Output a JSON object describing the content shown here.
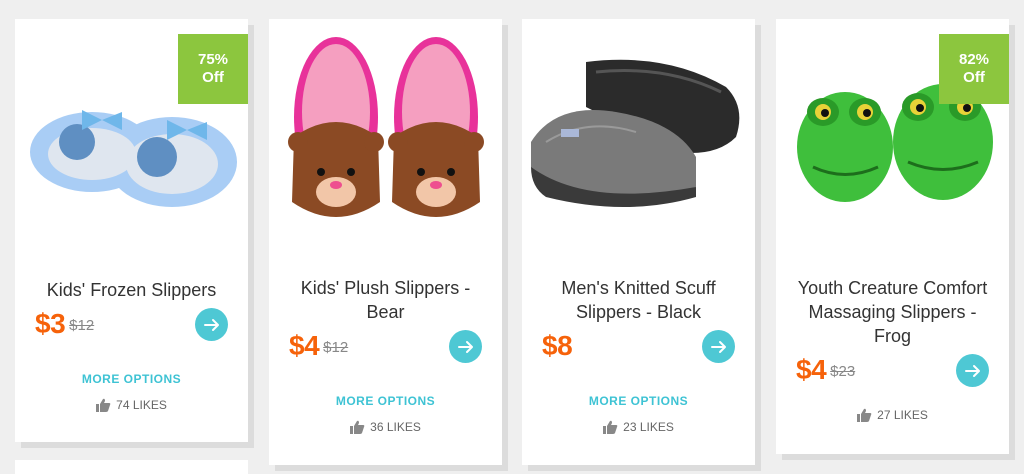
{
  "products": [
    {
      "title": "Kids' Frozen Slippers",
      "price": "$3",
      "old_price": "$12",
      "badge_percent": "75%",
      "badge_off": "Off",
      "more_options": "MORE OPTIONS",
      "likes": "74 LIKES"
    },
    {
      "title": "Kids' Plush Slippers - Bear",
      "price": "$4",
      "old_price": "$12",
      "more_options": "MORE OPTIONS",
      "likes": "36 LIKES"
    },
    {
      "title": "Men's Knitted Scuff Slippers - Black",
      "price": "$8",
      "old_price": "",
      "more_options": "MORE OPTIONS",
      "likes": "23 LIKES"
    },
    {
      "title": "Youth Creature Comfort Massaging Slippers - Frog",
      "price": "$4",
      "old_price": "$23",
      "badge_percent": "82%",
      "badge_off": "Off",
      "likes": "27 LIKES"
    }
  ],
  "icons": {
    "go": "arrow-right-icon",
    "likes": "thumbs-up-icon"
  },
  "colors": {
    "price": "#f6620a",
    "badge": "#8cc63e",
    "button": "#4ec8d4",
    "link": "#3ec3d4"
  }
}
